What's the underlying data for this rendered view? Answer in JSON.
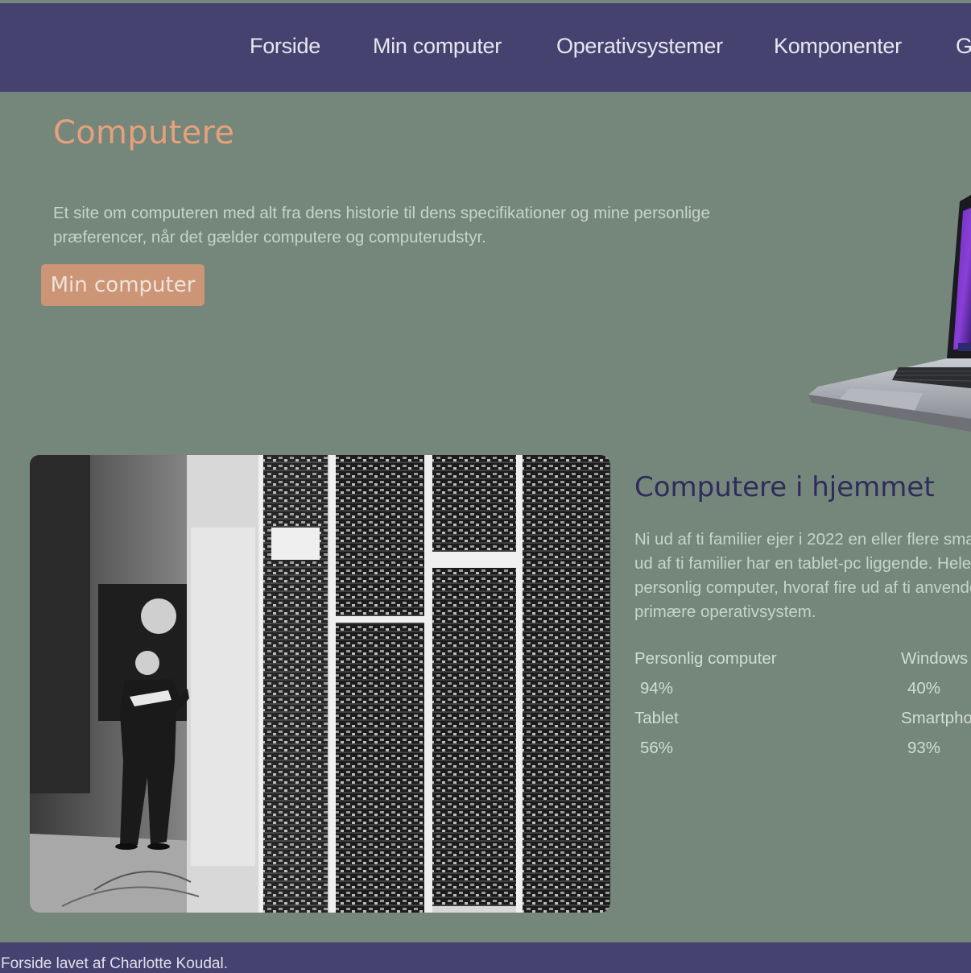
{
  "nav": {
    "items": [
      {
        "label": "Forside"
      },
      {
        "label": "Min computer"
      },
      {
        "label": "Operativsystemer"
      },
      {
        "label": "Komponenter"
      },
      {
        "label": "G"
      }
    ]
  },
  "hero": {
    "title": "Computere",
    "text_line1": "Et site om computeren med alt fra dens historie til dens specifikationer og mine personlige",
    "text_line2": "præferencer, når det gælder computere og computerudstyr.",
    "button_label": "Min computer"
  },
  "home": {
    "title": "Computere i hjemmet",
    "text_lines": [
      "Ni ud af ti familier ejer i 2022 en eller flere smar",
      "ud af ti familier har en tablet-pc liggende. Hele",
      "personlig computer, hvoraf fire ud af ti anvende",
      "primære operativsystem."
    ],
    "stats": [
      {
        "label": "Personlig computer",
        "value": "94%"
      },
      {
        "label": "Windows",
        "value": "40%"
      },
      {
        "label": "Tablet",
        "value": "56%"
      },
      {
        "label": "Smartpho",
        "value": "93%"
      }
    ]
  },
  "footer": {
    "credit": "Forside lavet af Charlotte Koudal."
  },
  "colors": {
    "background": "#75877b",
    "nav": "#454270",
    "accent": "#e6a07c",
    "button": "#cc9576",
    "section_title": "#2f2c5c"
  }
}
